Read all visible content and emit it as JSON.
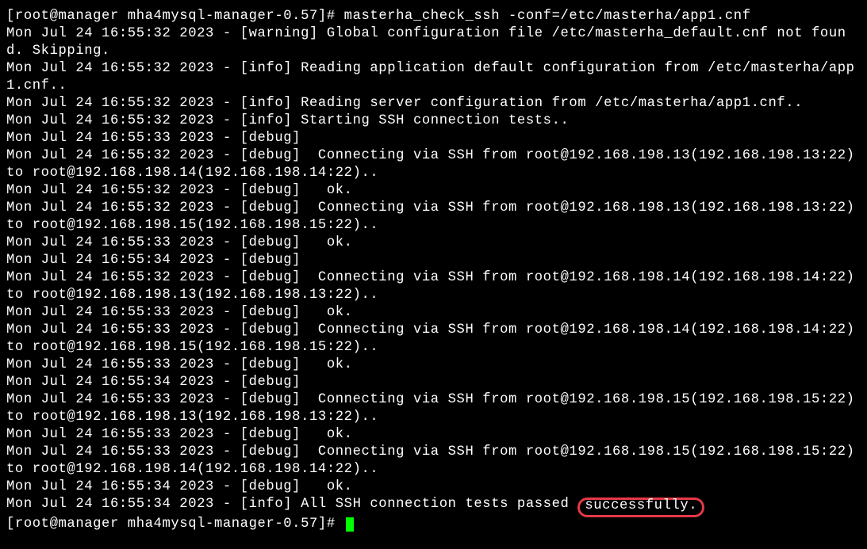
{
  "prompt1_user": "[root@manager mha4mysql-manager-0.57]# ",
  "command": "masterha_check_ssh -conf=/etc/masterha/app1.cnf",
  "lines": {
    "l1": "Mon Jul 24 16:55:32 2023 - [warning] Global configuration file /etc/masterha_default.cnf not found. Skipping.",
    "l2": "Mon Jul 24 16:55:32 2023 - [info] Reading application default configuration from /etc/masterha/app1.cnf..",
    "l3": "Mon Jul 24 16:55:32 2023 - [info] Reading server configuration from /etc/masterha/app1.cnf..",
    "l4": "Mon Jul 24 16:55:32 2023 - [info] Starting SSH connection tests..",
    "l5": "Mon Jul 24 16:55:33 2023 - [debug] ",
    "l6": "Mon Jul 24 16:55:32 2023 - [debug]  Connecting via SSH from root@192.168.198.13(192.168.198.13:22) to root@192.168.198.14(192.168.198.14:22)..",
    "l7": "Mon Jul 24 16:55:32 2023 - [debug]   ok.",
    "l8": "Mon Jul 24 16:55:32 2023 - [debug]  Connecting via SSH from root@192.168.198.13(192.168.198.13:22) to root@192.168.198.15(192.168.198.15:22)..",
    "l9": "Mon Jul 24 16:55:33 2023 - [debug]   ok.",
    "l10": "Mon Jul 24 16:55:34 2023 - [debug] ",
    "l11": "Mon Jul 24 16:55:32 2023 - [debug]  Connecting via SSH from root@192.168.198.14(192.168.198.14:22) to root@192.168.198.13(192.168.198.13:22)..",
    "l12": "Mon Jul 24 16:55:33 2023 - [debug]   ok.",
    "l13": "Mon Jul 24 16:55:33 2023 - [debug]  Connecting via SSH from root@192.168.198.14(192.168.198.14:22) to root@192.168.198.15(192.168.198.15:22)..",
    "l14": "Mon Jul 24 16:55:33 2023 - [debug]   ok.",
    "l15": "Mon Jul 24 16:55:34 2023 - [debug] ",
    "l16": "Mon Jul 24 16:55:33 2023 - [debug]  Connecting via SSH from root@192.168.198.15(192.168.198.15:22) to root@192.168.198.13(192.168.198.13:22)..",
    "l17": "Mon Jul 24 16:55:33 2023 - [debug]   ok.",
    "l18": "Mon Jul 24 16:55:33 2023 - [debug]  Connecting via SSH from root@192.168.198.15(192.168.198.15:22) to root@192.168.198.14(192.168.198.14:22)..",
    "l19": "Mon Jul 24 16:55:34 2023 - [debug]   ok.",
    "final_prefix": "Mon Jul 24 16:55:34 2023 - [info] All SSH connection tests passed ",
    "final_highlight": "successfully."
  },
  "prompt2": "[root@manager mha4mysql-manager-0.57]# "
}
